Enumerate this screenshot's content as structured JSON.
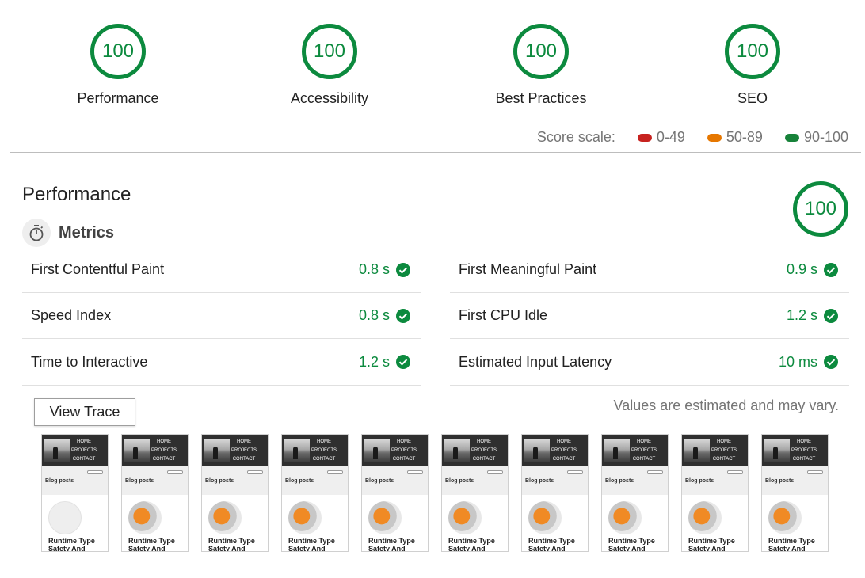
{
  "gauges": [
    {
      "score": "100",
      "label": "Performance"
    },
    {
      "score": "100",
      "label": "Accessibility"
    },
    {
      "score": "100",
      "label": "Best Practices"
    },
    {
      "score": "100",
      "label": "SEO"
    }
  ],
  "score_scale": {
    "label": "Score scale:",
    "ranges": [
      {
        "text": "0-49",
        "color": "#c7221f"
      },
      {
        "text": "50-89",
        "color": "#e67700"
      },
      {
        "text": "90-100",
        "color": "#178239"
      }
    ]
  },
  "section": {
    "title": "Performance",
    "score": "100"
  },
  "metrics": {
    "heading": "Metrics",
    "items": [
      {
        "name": "First Contentful Paint",
        "value": "0.8 s"
      },
      {
        "name": "First Meaningful Paint",
        "value": "0.9 s"
      },
      {
        "name": "Speed Index",
        "value": "0.8 s"
      },
      {
        "name": "First CPU Idle",
        "value": "1.2 s"
      },
      {
        "name": "Time to Interactive",
        "value": "1.2 s"
      },
      {
        "name": "Estimated Input Latency",
        "value": "10 ms"
      }
    ]
  },
  "view_trace_label": "View Trace",
  "estimate_note": "Values are estimated and may vary.",
  "filmstrip": {
    "nav": [
      "HOME",
      "PROJECTS",
      "CONTACT"
    ],
    "section_label": "Blog posts",
    "post_title": "Runtime Type Safety And",
    "frames": 10
  },
  "colors": {
    "pass": "#0c8a3e"
  }
}
